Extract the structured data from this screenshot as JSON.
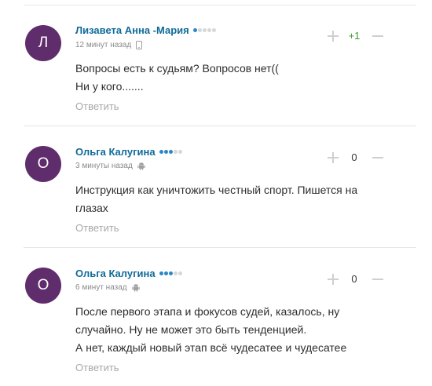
{
  "comments": [
    {
      "avatar_letter": "Л",
      "author": "Лизавета Анна -Мария",
      "rating_dots_filled": 1,
      "time": "12 минут назад",
      "device_icon": "mobile-phone-icon",
      "text_lines": [
        "Вопросы есть к судьям? Вопросов нет((",
        "Ни у кого......."
      ],
      "reply_label": "Ответить",
      "score": "+1"
    },
    {
      "avatar_letter": "О",
      "author": "Ольга Калугина",
      "rating_dots_filled": 3,
      "time": "3 минуты назад",
      "device_icon": "android-icon",
      "text_lines": [
        "Инструкция как уничтожить честный спорт. Пишется на",
        "глазах"
      ],
      "reply_label": "Ответить",
      "score": "0"
    },
    {
      "avatar_letter": "О",
      "author": "Ольга Калугина",
      "rating_dots_filled": 3,
      "time": "6 минут назад",
      "device_icon": "android-icon",
      "text_lines": [
        "После первого этапа и фокусов судей, казалось, ну",
        "случайно. Ну не может это быть тенденцией.",
        "А нет, каждый новый этап всё чудесатее и чудесатее"
      ],
      "reply_label": "Ответить",
      "score": "0"
    }
  ],
  "colors": {
    "avatar": "#5f2d6b",
    "author": "#0f6a99",
    "dot_active": "#2a87c8",
    "score_positive": "#3c9a2c"
  }
}
